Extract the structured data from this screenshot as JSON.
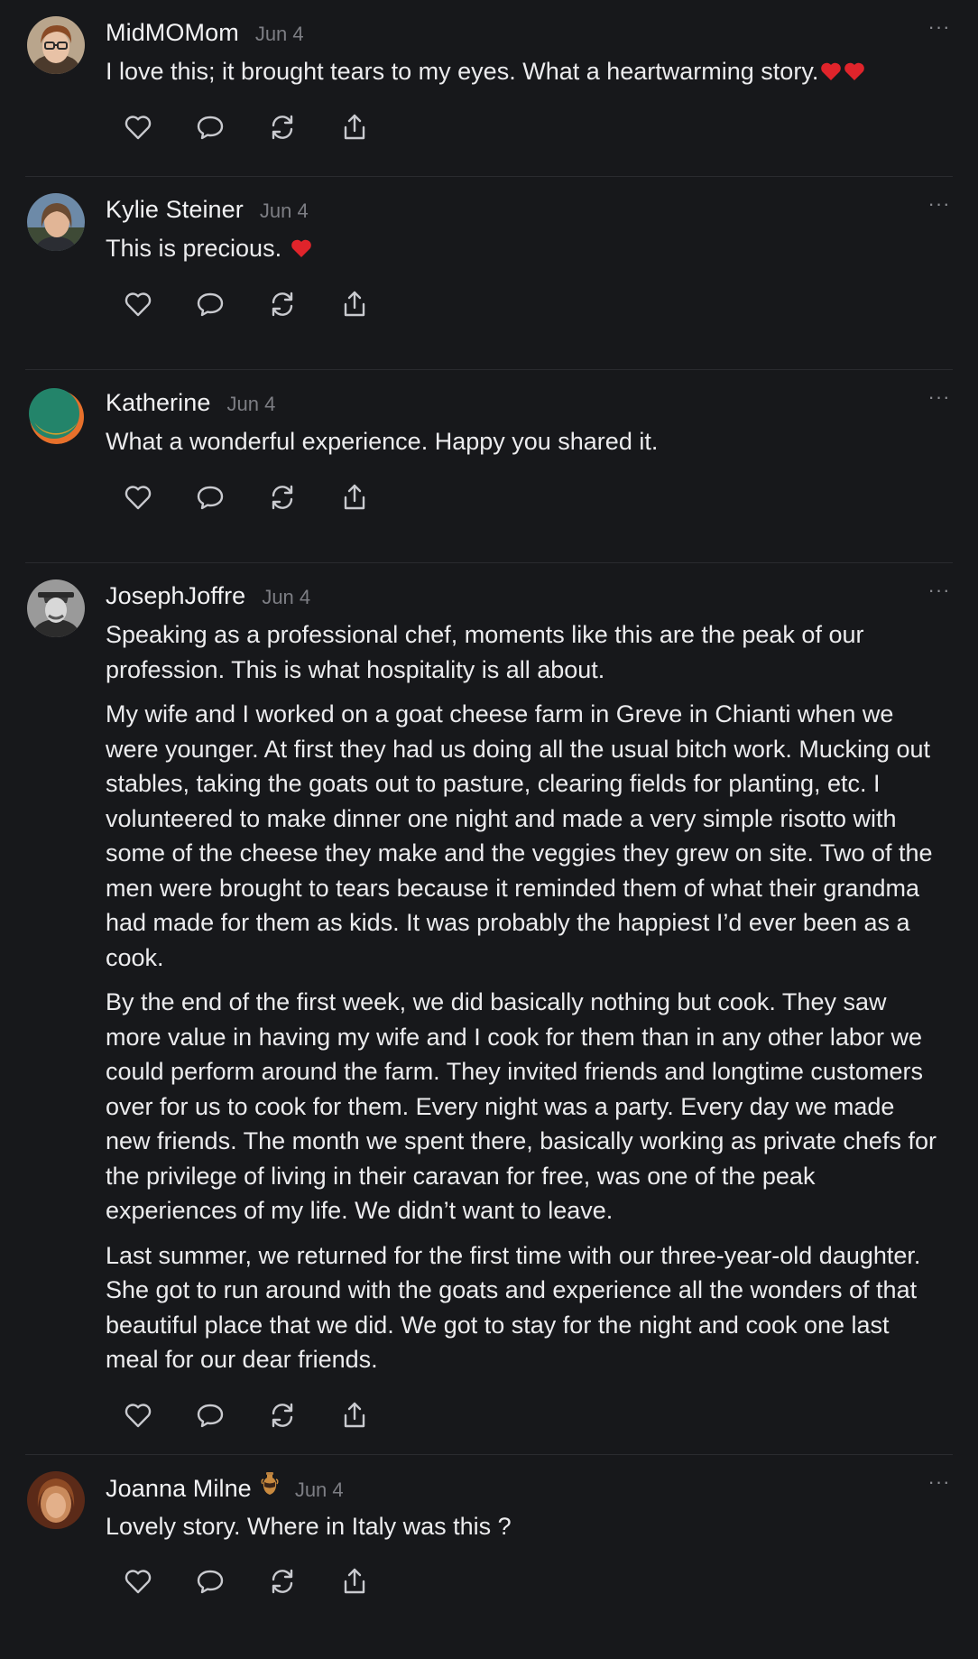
{
  "comments": [
    {
      "author": "MidMOMom",
      "date": "Jun 4",
      "paragraphs": [
        "I love this; it brought tears to my eyes. What a heartwarming story."
      ],
      "emoji_suffix": [
        "heart-emoji",
        "heart-emoji"
      ]
    },
    {
      "author": "Kylie Steiner",
      "date": "Jun 4",
      "paragraphs": [
        "This is precious. "
      ],
      "emoji_suffix": [
        "heart-emoji"
      ]
    },
    {
      "author": "Katherine",
      "date": "Jun 4",
      "paragraphs": [
        "What a wonderful experience. Happy you shared it."
      ],
      "emoji_suffix": []
    },
    {
      "author": "JosephJoffre",
      "date": "Jun 4",
      "paragraphs": [
        "Speaking as a professional chef, moments like this are the peak of our profession. This is what hospitality is all about.",
        "My wife and I worked on a goat cheese farm in Greve in Chianti when we were younger. At first they had us doing all the usual bitch work. Mucking out stables, taking the goats out to pasture, clearing fields for planting, etc. I volunteered to make dinner one night and made a very simple risotto with some of the cheese they make and the veggies they grew on site. Two of the men were brought to tears because it reminded them of what their grandma had made for them as kids. It was probably the happiest I’d ever been as a cook.",
        "By the end of the first week, we did basically nothing but cook. They saw more value in having my wife and I cook for them than in any other labor we could perform around the farm. They invited friends and longtime customers over for us to cook for them. Every night was a party. Every day we made new friends. The month we spent there, basically working as private chefs for the privilege of living in their caravan for free, was one of the peak experiences of my life. We didn’t want to leave.",
        "Last summer, we returned for the first time with our three-year-old daughter. She got to run around with the goats and experience all the wonders of that beautiful place that we did. We got to stay for the night and cook one last meal for our dear friends."
      ],
      "emoji_suffix": []
    },
    {
      "author": "Joanna Milne",
      "badge_icon": "amphora-icon",
      "date": "Jun 4",
      "paragraphs": [
        "Lovely story. Where in Italy was this ?"
      ],
      "emoji_suffix": []
    }
  ],
  "icons": {
    "like": "heart-outline-icon",
    "reply": "speech-bubble-icon",
    "restack": "refresh-arrows-icon",
    "share": "share-upload-icon",
    "more": "ellipsis-icon"
  },
  "more_label": "···",
  "colors": {
    "background": "#17181b",
    "text": "#ececee",
    "muted": "#7d7e84",
    "divider": "#2a2b2f",
    "heart_emoji": "#e0242b"
  }
}
